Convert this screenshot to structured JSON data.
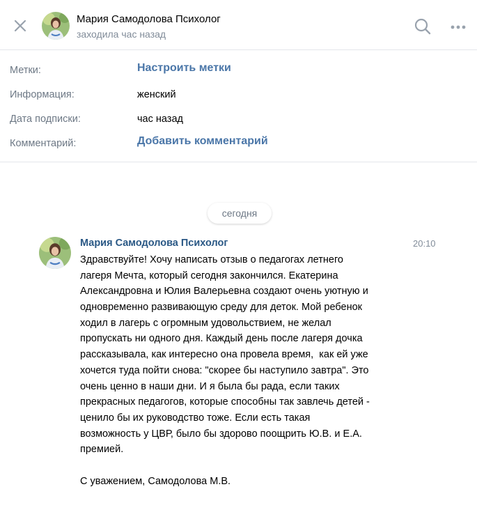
{
  "header": {
    "name": "Мария Самодолова Психолог",
    "status": "заходила час назад",
    "icons": {
      "close": "close-icon",
      "search": "search-icon",
      "more": "more-icon"
    }
  },
  "info": {
    "rows": [
      {
        "label": "Метки:",
        "value": "Настроить метки",
        "kind": "link"
      },
      {
        "label": "Информация:",
        "value": "женский",
        "kind": "text"
      },
      {
        "label": "Дата подписки:",
        "value": "час назад",
        "kind": "text"
      },
      {
        "label": "Комментарий:",
        "value": "Добавить комментарий",
        "kind": "link"
      }
    ]
  },
  "date_separator": "сегодня",
  "message": {
    "author": "Мария Самодолова Психолог",
    "time": "20:10",
    "lines": [
      "Здравствуйте! Хочу написать отзыв о педагогах летнего",
      "лагеря Мечта, который сегодня закончился. Екатерина",
      "Александровна и Юлия Валерьевна создают очень уютную и",
      "одновременно развивающую среду для деток. Мой ребенок",
      "ходил в лагерь с огромным удовольствием, не желал",
      "пропускать ни одного дня. Каждый день после лагеря дочка",
      "рассказывала, как интересно она провела время,  как ей уже",
      "хочется туда пойти снова: \"скорее бы наступило завтра\". Это",
      "очень ценно в наши дни. И я была бы рада, если таких",
      "прекрасных педагогов, которые способны так завлечь детей -",
      "ценило бы их руководство тоже. Если есть такая",
      "возможность у ЦВР, было бы здорово поощрить Ю.В. и Е.А.",
      "премией.",
      "",
      "С уважением, Самодолова М.В."
    ]
  },
  "colors": {
    "link": "#4a76a8",
    "author": "#2a5885",
    "secondary_text": "#818c99",
    "divider": "#e4e6ea",
    "icon": "#99a2ad"
  }
}
